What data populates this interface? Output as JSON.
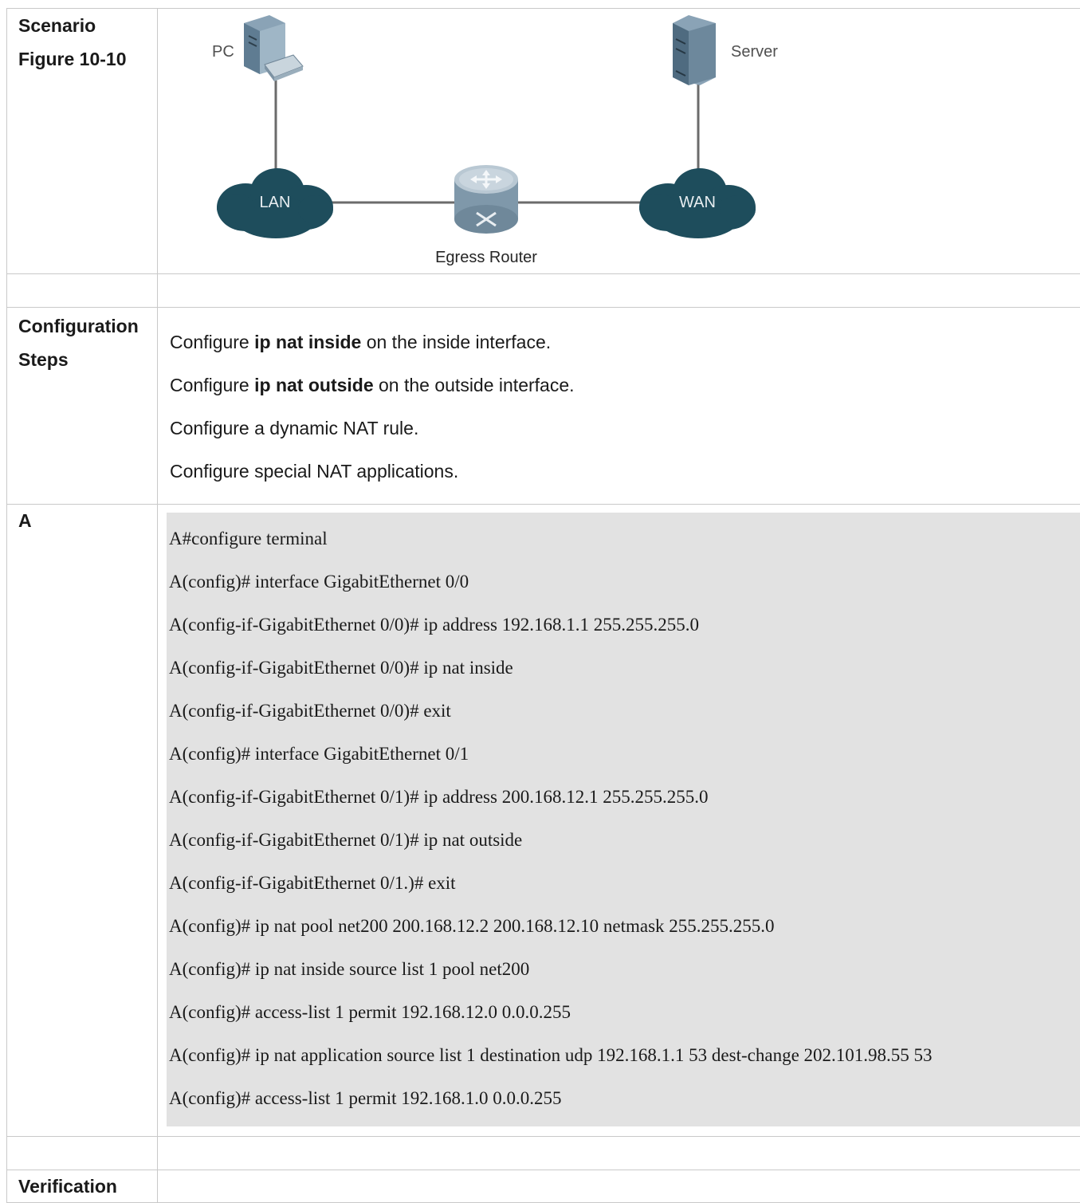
{
  "rows": {
    "scenario": {
      "label_line1": "Scenario",
      "label_line2": "Figure 10-10"
    },
    "steps": {
      "label_line1": "Configuration",
      "label_line2": "Steps",
      "items": [
        {
          "pre": "Configure ",
          "bold": "ip nat inside",
          "post": " on the inside interface."
        },
        {
          "pre": "Configure ",
          "bold": "ip nat outside",
          "post": " on the outside interface."
        },
        {
          "text": "Configure a dynamic NAT rule."
        },
        {
          "text": "Configure special NAT applications."
        }
      ]
    },
    "device": {
      "label": "A",
      "code": [
        "A#configure terminal",
        "A(config)# interface GigabitEthernet 0/0",
        "A(config-if-GigabitEthernet 0/0)# ip address 192.168.1.1 255.255.255.0",
        "A(config-if-GigabitEthernet 0/0)# ip nat inside",
        "A(config-if-GigabitEthernet 0/0)# exit",
        "A(config)# interface GigabitEthernet 0/1",
        "A(config-if-GigabitEthernet 0/1)# ip address 200.168.12.1 255.255.255.0",
        "A(config-if-GigabitEthernet 0/1)# ip nat outside",
        "A(config-if-GigabitEthernet 0/1.)# exit",
        "A(config)# ip nat pool net200 200.168.12.2 200.168.12.10 netmask 255.255.255.0",
        "A(config)# ip nat inside source list 1 pool net200",
        "A(config)# access-list 1 permit 192.168.12.0 0.0.0.255",
        "A(config)# ip nat application source list 1 destination udp 192.168.1.1 53 dest-change 202.101.98.55 53",
        "A(config)# access-list 1 permit 192.168.1.0 0.0.0.255"
      ]
    },
    "verification": {
      "label": "Verification"
    }
  },
  "diagram": {
    "pc_label": "PC",
    "server_label": "Server",
    "lan_label": "LAN",
    "wan_label": "WAN",
    "router_label": "Egress Router",
    "cloud_color": "#1e4d5c",
    "device_color": "#6f8fa6"
  }
}
